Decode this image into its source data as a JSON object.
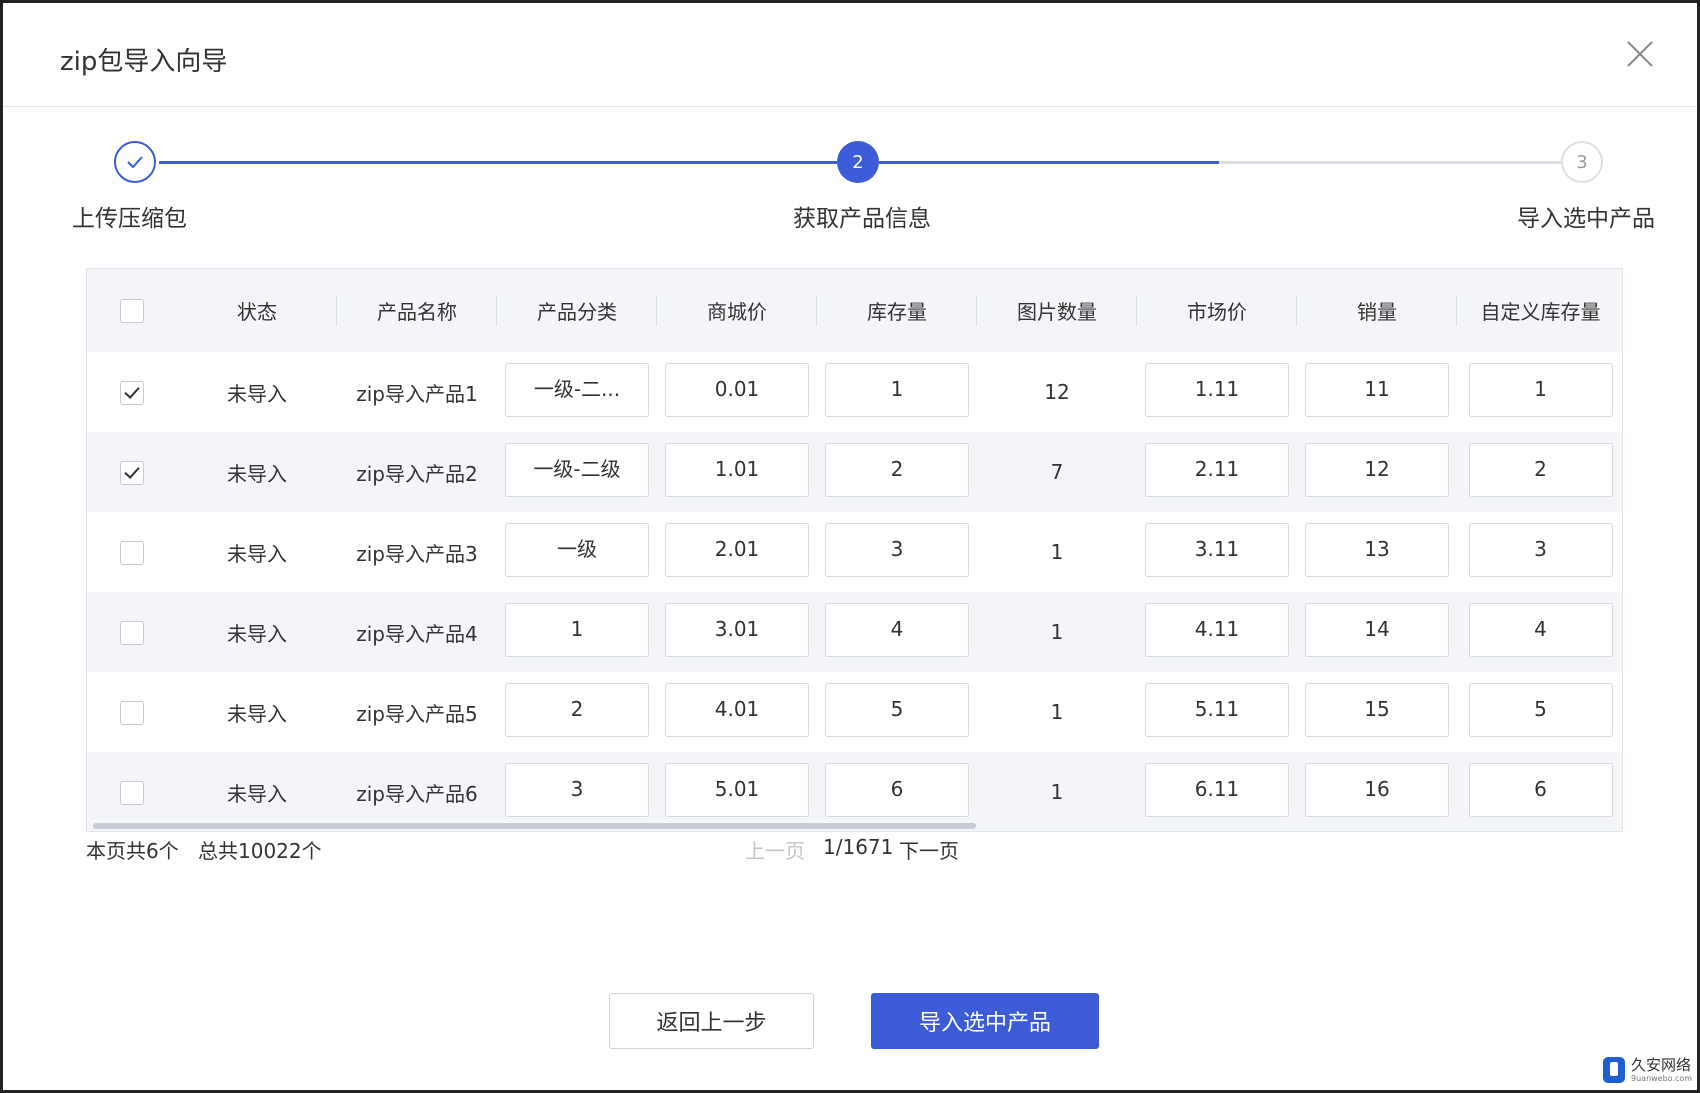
{
  "dialog": {
    "title": "zip包导入向导"
  },
  "steps": [
    {
      "label": "上传压缩包",
      "status": "done"
    },
    {
      "label": "获取产品信息",
      "number": "2",
      "status": "active"
    },
    {
      "label": "导入选中产品",
      "number": "3",
      "status": "pending"
    }
  ],
  "table": {
    "columns": [
      "状态",
      "产品名称",
      "产品分类",
      "商城价",
      "库存量",
      "图片数量",
      "市场价",
      "销量",
      "自定义库存量"
    ],
    "rows": [
      {
        "checked": true,
        "status": "未导入",
        "name": "zip导入产品1",
        "category": "一级-二...",
        "mall_price": "0.01",
        "stock": "1",
        "images": "12",
        "market_price": "1.11",
        "sales": "11",
        "custom_stock": "1"
      },
      {
        "checked": true,
        "status": "未导入",
        "name": "zip导入产品2",
        "category": "一级-二级",
        "mall_price": "1.01",
        "stock": "2",
        "images": "7",
        "market_price": "2.11",
        "sales": "12",
        "custom_stock": "2"
      },
      {
        "checked": false,
        "status": "未导入",
        "name": "zip导入产品3",
        "category": "一级",
        "mall_price": "2.01",
        "stock": "3",
        "images": "1",
        "market_price": "3.11",
        "sales": "13",
        "custom_stock": "3"
      },
      {
        "checked": false,
        "status": "未导入",
        "name": "zip导入产品4",
        "category": "1",
        "mall_price": "3.01",
        "stock": "4",
        "images": "1",
        "market_price": "4.11",
        "sales": "14",
        "custom_stock": "4"
      },
      {
        "checked": false,
        "status": "未导入",
        "name": "zip导入产品5",
        "category": "2",
        "mall_price": "4.01",
        "stock": "5",
        "images": "1",
        "market_price": "5.11",
        "sales": "15",
        "custom_stock": "5"
      },
      {
        "checked": false,
        "status": "未导入",
        "name": "zip导入产品6",
        "category": "3",
        "mall_price": "5.01",
        "stock": "6",
        "images": "1",
        "market_price": "6.11",
        "sales": "16",
        "custom_stock": "6"
      }
    ]
  },
  "summary": {
    "page_count": "本页共6个",
    "total_count": "总共10022个"
  },
  "pagination": {
    "prev": "上一页",
    "current": "1/1671",
    "next": "下一页"
  },
  "buttons": {
    "back": "返回上一步",
    "import": "导入选中产品"
  },
  "watermark": {
    "name": "久安网络",
    "url": "9uanwebo.com"
  },
  "colors": {
    "primary": "#3d5bd6",
    "line_inactive": "#dddfe4",
    "header_bg": "#f3f5f8"
  },
  "icons": {
    "close": "close-icon",
    "step_done": "check-icon"
  }
}
